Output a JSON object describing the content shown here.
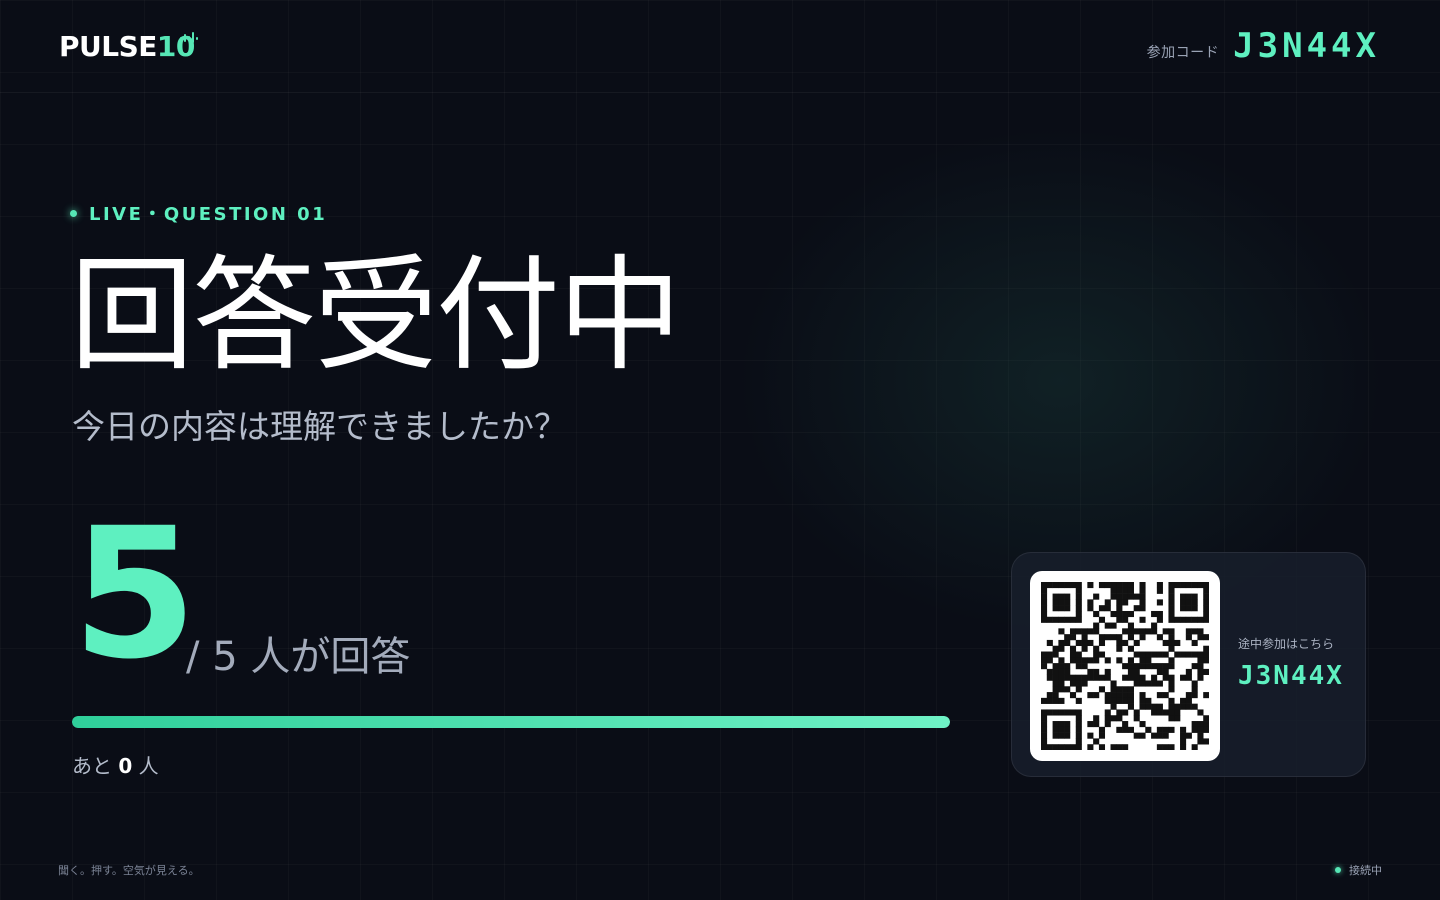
{
  "header": {
    "logo_word": "PULSE",
    "logo_num": "10",
    "code_label": "参加コード",
    "code_value": "J3N44X"
  },
  "session": {
    "live_label": "LIVE・QUESTION 01",
    "status_title": "回答受付中",
    "question": "今日の内容は理解できましたか？"
  },
  "responses": {
    "answered": "5",
    "total_text": "/ 5 人が回答",
    "progress": 1.0,
    "remaining_prefix": "あと",
    "remaining_count": "0",
    "remaining_suffix": "人"
  },
  "join_card": {
    "label": "途中参加はこちら",
    "code": "J3N44X"
  },
  "footer": {
    "tagline": "聞く。押す。空気が見える。",
    "connection_status": "接続中"
  },
  "colors": {
    "accent": "#5ef0c0",
    "background": "#0a0d16",
    "card": "#181e2c"
  },
  "icons": {
    "logo_mark": "pulse-wave-icon",
    "live_indicator": "live-dot-icon",
    "qr": "qr-code-icon",
    "connection": "status-dot-icon"
  }
}
